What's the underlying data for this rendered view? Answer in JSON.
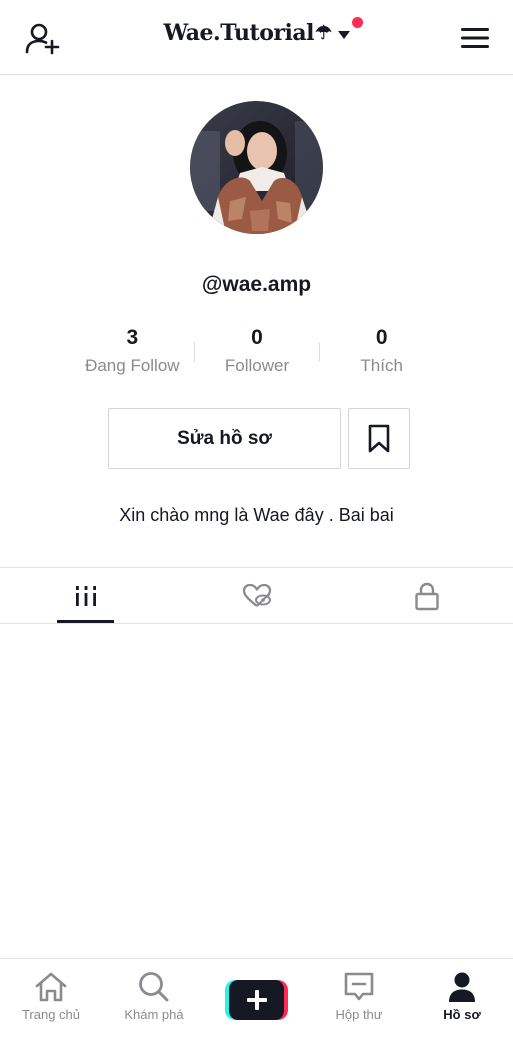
{
  "header": {
    "title": "Wae.Tutorial",
    "title_suffix": "☂",
    "accent_color": "#fe2c55"
  },
  "profile": {
    "username": "@wae.amp",
    "bio": "Xin chào mng là Wae đây . Bai bai",
    "stats": [
      {
        "value": "3",
        "label": "Đang Follow"
      },
      {
        "value": "0",
        "label": "Follower"
      },
      {
        "value": "0",
        "label": "Thích"
      }
    ],
    "edit_label": "Sửa hồ sơ"
  },
  "tabs": [
    {
      "icon": "videos-grid-icon",
      "active": true
    },
    {
      "icon": "liked-hidden-icon",
      "active": false
    },
    {
      "icon": "lock-icon",
      "active": false
    }
  ],
  "bottom_nav": {
    "items": [
      {
        "label": "Trang chủ",
        "icon": "home-icon",
        "active": false
      },
      {
        "label": "Khám phá",
        "icon": "search-icon",
        "active": false
      },
      {
        "label": "Hộp thư",
        "icon": "inbox-icon",
        "active": false
      },
      {
        "label": "Hồ sơ",
        "icon": "profile-icon",
        "active": true
      }
    ],
    "create_colors": {
      "cyan": "#25f4ee",
      "red": "#fe2c55",
      "black": "#161823"
    }
  }
}
